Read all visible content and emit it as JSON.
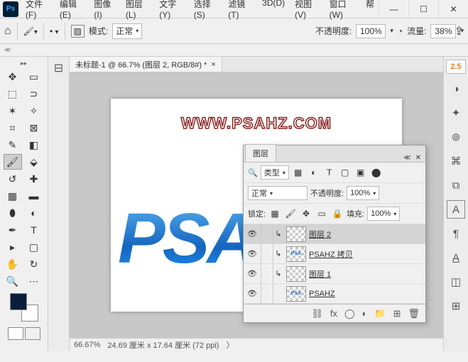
{
  "app_icon": "Ps",
  "menu": [
    "文件(F)",
    "编辑(E)",
    "图像(I)",
    "图层(L)",
    "文字(Y)",
    "选择(S)",
    "滤镜(T)",
    "3D(D)",
    "视图(V)",
    "窗口(W)",
    "帮"
  ],
  "optbar": {
    "mode_label": "模式:",
    "mode_value": "正常",
    "opacity_label": "不透明度:",
    "opacity_value": "100%",
    "flow_label": "流量:",
    "flow_value": "38%"
  },
  "doc_tab": {
    "title": "未标题-1 @ 66.7% (图层 2, RGB/8#) *",
    "close": "×"
  },
  "canvas": {
    "watermark": "WWW.PSAHZ.COM",
    "text": "PSA"
  },
  "status": {
    "zoom": "66.67%",
    "dim": "24.69 厘米 x 17.64 厘米 (72 ppi)"
  },
  "dockright": {
    "badge": "2.5",
    "letter": "A"
  },
  "layers": {
    "tab": "图层",
    "filter_label": "类型",
    "blend_mode": "正常",
    "opacity_label": "不透明度:",
    "opacity_value": "100%",
    "lock_label": "锁定:",
    "fill_label": "填充:",
    "fill_value": "100%",
    "items": [
      {
        "name": "图层 2",
        "selected": true
      },
      {
        "name": "PSAHZ 拷贝",
        "selected": false
      },
      {
        "name": "图层 1",
        "selected": false
      },
      {
        "name": "PSAHZ",
        "selected": false
      }
    ]
  }
}
